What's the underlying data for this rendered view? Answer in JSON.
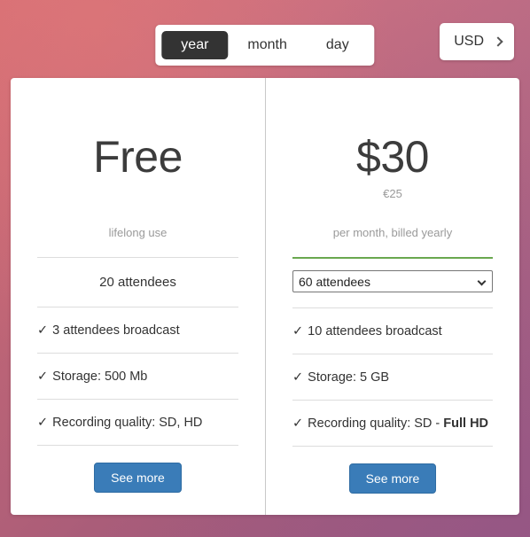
{
  "topbar": {
    "period_switch": {
      "options": [
        {
          "label": "year",
          "active": true
        },
        {
          "label": "month",
          "active": false
        },
        {
          "label": "day",
          "active": false
        }
      ]
    },
    "currency": {
      "label": "USD",
      "icon": "chevron-right-icon"
    }
  },
  "plans": [
    {
      "price": "Free",
      "price_alt": "",
      "subtitle": "lifelong use",
      "divider_accent": false,
      "attendees_label": "20 attendees",
      "attendees_is_select": false,
      "features": [
        {
          "tick": "✓",
          "text": "3 attendees broadcast",
          "bold": ""
        },
        {
          "tick": "✓",
          "text": "Storage: 500 Mb",
          "bold": ""
        },
        {
          "tick": "✓",
          "text": "Recording quality: SD, HD",
          "bold": ""
        }
      ],
      "cta_label": "See more"
    },
    {
      "price": "$30",
      "price_alt": "€25",
      "subtitle": "per month, billed yearly",
      "divider_accent": true,
      "attendees_label": "60 attendees",
      "attendees_is_select": true,
      "attendees_options": [
        "60 attendees"
      ],
      "features": [
        {
          "tick": "✓",
          "text": "10 attendees broadcast",
          "bold": ""
        },
        {
          "tick": "✓",
          "text": "Storage: 5 GB",
          "bold": ""
        },
        {
          "tick": "✓",
          "text": "Recording quality: SD - ",
          "bold": "Full HD"
        }
      ],
      "cta_label": "See more"
    }
  ],
  "colors": {
    "accent_green": "#6aa84f",
    "primary_blue": "#3a7cb8",
    "active_toggle": "#333333"
  }
}
